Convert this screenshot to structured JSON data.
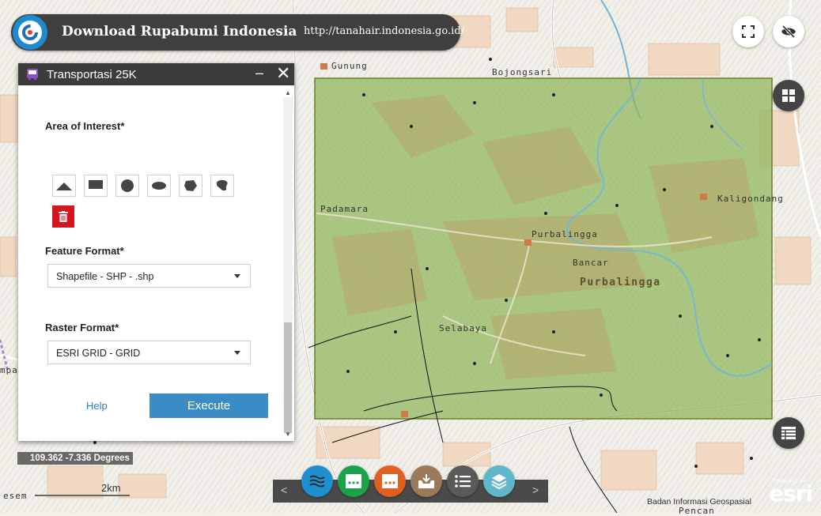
{
  "banner": {
    "title": "Download Rupabumi Indonesia",
    "url": "http://tanahair.indonesia.go.id/"
  },
  "map": {
    "places": [
      "Gunung",
      "Bojongsari",
      "Padamara",
      "Kaligondang",
      "Purbalingga",
      "Bancar",
      "Purbalingga",
      "Selabaya",
      "mpa",
      "esem",
      "Pencan"
    ],
    "aoi_fill": "#8fb55a",
    "aoi_border": "#6b7a2a"
  },
  "panel": {
    "title": "Transportasi 25K",
    "minimize": "–",
    "close": "✕",
    "area_label": "Area of Interest*",
    "draw_tools": [
      "triangle-icon",
      "rectangle-icon",
      "circle-icon",
      "ellipse-icon",
      "polygon-icon",
      "freehand-icon"
    ],
    "feature_label": "Feature Format*",
    "feature_value": "Shapefile - SHP - .shp",
    "raster_label": "Raster Format*",
    "raster_value": "ESRI GRID - GRID",
    "help": "Help",
    "execute": "Execute"
  },
  "status": {
    "coords": "109.362 -7.336 Degrees",
    "scale": "2km"
  },
  "toolbar": {
    "prev": "<",
    "next": ">",
    "buttons": [
      {
        "icon": "water-icon",
        "color": "#1f8fd0"
      },
      {
        "icon": "dots-card-green-icon",
        "color": "#1aa34a"
      },
      {
        "icon": "dots-card-orange-icon",
        "color": "#e1601f"
      },
      {
        "icon": "download-tray-icon",
        "color": "#9b7a5a"
      },
      {
        "icon": "list-icon",
        "color": "#5a5a5a"
      },
      {
        "icon": "layers-icon",
        "color": "#5fb7c9"
      }
    ]
  },
  "footer": {
    "credit": "Badan Informasi Geospasial",
    "esri_sub": "POWERED BY",
    "esri": "esri"
  }
}
